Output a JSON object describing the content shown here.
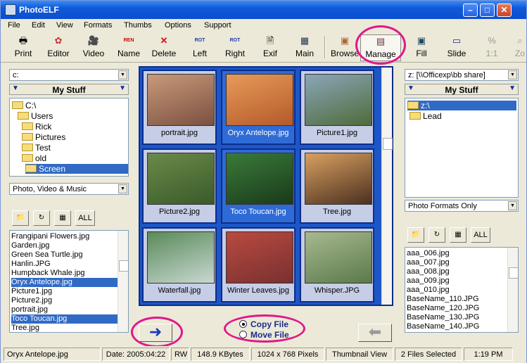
{
  "window": {
    "title": "PhotoELF"
  },
  "menu": [
    "File",
    "Edit",
    "View",
    "Formats",
    "Thumbs",
    "Options",
    "Support"
  ],
  "toolbar": [
    {
      "label": "Print",
      "icon": "printer-icon"
    },
    {
      "label": "Editor",
      "icon": "palette-icon"
    },
    {
      "label": "Video",
      "icon": "camera-icon"
    },
    {
      "label": "Name",
      "icon": "rename-icon",
      "icon_text": "REN"
    },
    {
      "label": "Delete",
      "icon": "delete-x-icon"
    },
    {
      "label": "Left",
      "icon": "rotate-left-icon",
      "icon_text": "ROT"
    },
    {
      "label": "Right",
      "icon": "rotate-right-icon",
      "icon_text": "ROT"
    },
    {
      "label": "Exif",
      "icon": "exif-doc-icon"
    },
    {
      "label": "Main",
      "icon": "main-grid-icon"
    },
    {
      "label": "Browse",
      "icon": "browse-icon"
    },
    {
      "label": "Manage",
      "icon": "manage-film-icon"
    },
    {
      "label": "Fill",
      "icon": "fill-icon"
    },
    {
      "label": "Slide",
      "icon": "slide-icon"
    },
    {
      "label": "1:1",
      "icon": "one-to-one-icon"
    },
    {
      "label": "Zo",
      "icon": "zoom-icon"
    }
  ],
  "left": {
    "drive": "c:",
    "bar_title": "My Stuff",
    "tree": [
      {
        "label": "C:\\",
        "indent": 0
      },
      {
        "label": "Users",
        "indent": 1
      },
      {
        "label": "Rick",
        "indent": 2
      },
      {
        "label": "Pictures",
        "indent": 3
      },
      {
        "label": "Test",
        "indent": 4
      },
      {
        "label": "old",
        "indent": 5
      },
      {
        "label": "Screen",
        "indent": 5,
        "selected": true
      }
    ],
    "filter": "Photo, Video & Music",
    "all_label": "ALL",
    "files": [
      {
        "name": "Frangipani Flowers.jpg"
      },
      {
        "name": "Garden.jpg"
      },
      {
        "name": "Green Sea Turtle.jpg"
      },
      {
        "name": "Hanlin.JPG"
      },
      {
        "name": "Humpback Whale.jpg"
      },
      {
        "name": "Oryx Antelope.jpg",
        "selected": true
      },
      {
        "name": "Picture1.jpg"
      },
      {
        "name": "Picture2.jpg"
      },
      {
        "name": "portrait.jpg"
      },
      {
        "name": "Toco Toucan.jpg",
        "selected": true
      },
      {
        "name": "Tree.jpg"
      }
    ]
  },
  "thumbnails": [
    {
      "caption": "portrait.jpg",
      "selected": false,
      "colors": [
        "#c99a7a",
        "#7a5040"
      ]
    },
    {
      "caption": "Oryx Antelope.jpg",
      "selected": true,
      "colors": [
        "#e89a5a",
        "#b45a2a"
      ]
    },
    {
      "caption": "Picture1.jpg",
      "selected": false,
      "colors": [
        "#8aa6b8",
        "#4f6b3a"
      ]
    },
    {
      "caption": "Picture2.jpg",
      "selected": false,
      "colors": [
        "#6a8a4a",
        "#3a5a2a"
      ]
    },
    {
      "caption": "Toco Toucan.jpg",
      "selected": true,
      "colors": [
        "#3a7a3a",
        "#1a3a1a"
      ]
    },
    {
      "caption": "Tree.jpg",
      "selected": false,
      "colors": [
        "#d9a060",
        "#4a3020"
      ]
    },
    {
      "caption": "Waterfall.jpg",
      "selected": false,
      "colors": [
        "#5a8a5a",
        "#c8d8d0"
      ]
    },
    {
      "caption": "Winter Leaves.jpg",
      "selected": false,
      "colors": [
        "#b84a40",
        "#7a3030"
      ]
    },
    {
      "caption": "Whisper.JPG",
      "selected": false,
      "colors": [
        "#a8b890",
        "#5a7a4a"
      ]
    }
  ],
  "transfer": {
    "copy": "Copy File",
    "move": "Move File",
    "selected": "copy"
  },
  "right": {
    "drive": "z: [\\\\Officexp\\bb share]",
    "bar_title": "My Stuff",
    "tree": [
      {
        "label": "z:\\",
        "indent": 0,
        "selected": true
      },
      {
        "label": "Lead",
        "indent": 1
      }
    ],
    "filter": "Photo Formats Only",
    "all_label": "ALL",
    "files": [
      {
        "name": "aaa_006.jpg"
      },
      {
        "name": "aaa_007.jpg"
      },
      {
        "name": "aaa_008.jpg"
      },
      {
        "name": "aaa_009.jpg"
      },
      {
        "name": "aaa_010.jpg"
      },
      {
        "name": "BaseName_110.JPG"
      },
      {
        "name": "BaseName_120.JPG"
      },
      {
        "name": "BaseName_130.JPG"
      },
      {
        "name": "BaseName_140.JPG"
      }
    ]
  },
  "status": [
    "Oryx Antelope.jpg",
    "Date: 2005:04:22",
    "RW",
    "148.9 KBytes",
    "1024 x 768 Pixels",
    "Thumbnail View",
    "2 Files Selected",
    "1:19 PM"
  ]
}
